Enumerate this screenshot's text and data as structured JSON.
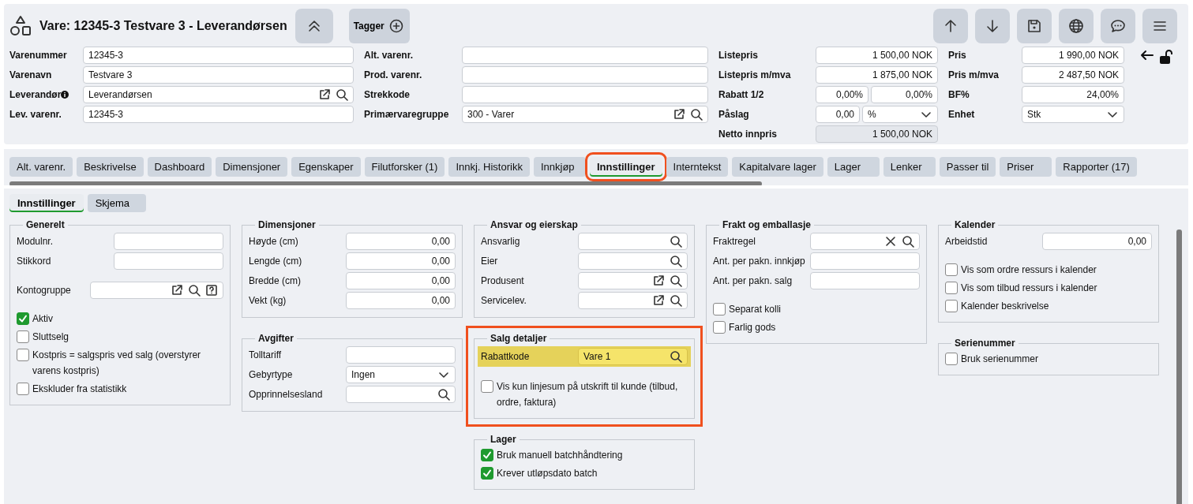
{
  "header": {
    "title": "Vare: 12345-3 Testvare 3 - Leverandørsen",
    "tags_button": "Tagger",
    "toolbar": [
      {
        "kind": "up"
      },
      {
        "kind": "down"
      },
      {
        "kind": "save"
      },
      {
        "kind": "globe"
      },
      {
        "kind": "chat"
      },
      {
        "kind": "menu"
      }
    ]
  },
  "header_fields": [
    [
      {
        "label": "Varenummer",
        "kind": "text",
        "value": "12345-3"
      },
      {
        "label": "Varenavn",
        "kind": "text",
        "value": "Testvare 3"
      },
      {
        "label": "Leverandør",
        "info": true,
        "kind": "lookup",
        "value": "Leverandørsen",
        "actions": [
          {
            "kind": "open"
          },
          {
            "kind": "search"
          }
        ]
      },
      {
        "label": "Lev. varenr.",
        "kind": "text",
        "value": "12345-3"
      }
    ],
    [
      {
        "label": "Alt. varenr.",
        "kind": "text"
      },
      {
        "label": "Prod. varenr.",
        "kind": "text"
      },
      {
        "label": "Strekkode",
        "kind": "text"
      },
      {
        "label": "Primærvaregruppe",
        "kind": "lookup",
        "value": "300 - Varer",
        "actions": [
          {
            "kind": "open"
          },
          {
            "kind": "search"
          }
        ]
      }
    ],
    [
      {
        "label": "Listepris",
        "kind": "number",
        "value": "1 500,00  NOK"
      },
      {
        "label": "Listepris m/mva",
        "kind": "number",
        "value": "1 875,00  NOK"
      },
      {
        "label": "Rabatt 1/2",
        "kind": "pair",
        "parts": [
          {
            "kind": "number",
            "value": "0,00%"
          },
          {
            "kind": "number",
            "value": "0,00%"
          }
        ]
      },
      {
        "label": "Påslag",
        "kind": "pair",
        "parts": [
          {
            "kind": "number",
            "value": "0,00"
          },
          {
            "kind": "select",
            "value": "%"
          }
        ]
      },
      {
        "label": "Netto innpris",
        "kind": "readonly",
        "value": "1 500,00 NOK"
      }
    ],
    [
      {
        "label": "Pris",
        "kind": "number",
        "value": "1 990,00 NOK"
      },
      {
        "label": "Pris m/mva",
        "kind": "number",
        "value": "2 487,50 NOK"
      },
      {
        "label": "BF%",
        "kind": "number",
        "value": "24,00%"
      },
      {
        "label": "Enhet",
        "kind": "select",
        "value": "Stk"
      }
    ]
  ],
  "price_lock": {
    "locked": false
  },
  "tabs": [
    {
      "label": "Alt. varenr.",
      "selected": false,
      "highlighted": false
    },
    {
      "label": "Beskrivelse",
      "selected": false,
      "highlighted": false
    },
    {
      "label": "Dashboard",
      "selected": false,
      "highlighted": false
    },
    {
      "label": "Dimensjoner",
      "selected": false,
      "highlighted": false
    },
    {
      "label": "Egenskaper",
      "selected": false,
      "highlighted": false
    },
    {
      "label": "Filutforsker (1)",
      "selected": false,
      "highlighted": false
    },
    {
      "label": "Innkj. Historikk",
      "selected": false,
      "highlighted": false
    },
    {
      "label": "Innkjøp",
      "selected": false,
      "highlighted": false
    },
    {
      "label": "Innstillinger",
      "selected": true,
      "highlighted": true
    },
    {
      "label": "Interntekst",
      "selected": false,
      "highlighted": false
    },
    {
      "label": "Kapitalvare lager",
      "selected": false,
      "highlighted": false
    },
    {
      "label": "Lager",
      "selected": false,
      "highlighted": false
    },
    {
      "label": "Lenker",
      "selected": false,
      "highlighted": false
    },
    {
      "label": "Passer til",
      "selected": false,
      "highlighted": false
    },
    {
      "label": "Priser",
      "selected": false,
      "highlighted": false
    },
    {
      "label": "Rapporter (17)",
      "selected": false,
      "highlighted": false
    }
  ],
  "subtabs": [
    {
      "label": "Innstillinger",
      "selected": true
    },
    {
      "label": "Skjema",
      "selected": false
    }
  ],
  "groups": [
    [
      {
        "title": "Generelt",
        "highlighted": false,
        "rows": [
          {
            "kind": "text-field",
            "label": "Modulnr."
          },
          {
            "kind": "text-field",
            "label": "Stikkord"
          },
          {
            "kind": "lookup-field",
            "label": "Kontogruppe",
            "actions": [
              {
                "kind": "open"
              },
              {
                "kind": "search"
              },
              {
                "kind": "help"
              }
            ]
          },
          {
            "kind": "checkbox",
            "label": "Aktiv",
            "checked": true
          },
          {
            "kind": "checkbox",
            "label": "Sluttselg",
            "checked": false
          },
          {
            "kind": "checkbox",
            "label": "Kostpris = salgspris ved salg (overstyrer varens kostpris)",
            "checked": false
          },
          {
            "kind": "checkbox",
            "label": "Ekskluder fra statistikk",
            "checked": false
          }
        ]
      }
    ],
    [
      {
        "title": "Dimensjoner",
        "highlighted": false,
        "rows": [
          {
            "kind": "number-field",
            "label": "Høyde (cm)",
            "value": "0,00"
          },
          {
            "kind": "number-field",
            "label": "Lengde (cm)",
            "value": "0,00"
          },
          {
            "kind": "number-field",
            "label": "Bredde (cm)",
            "value": "0,00"
          },
          {
            "kind": "number-field",
            "label": "Vekt (kg)",
            "value": "0,00"
          }
        ]
      },
      {
        "title": "Avgifter",
        "highlighted": false,
        "rows": [
          {
            "kind": "text-field",
            "label": "Tolltariff"
          },
          {
            "kind": "select-field",
            "label": "Gebyrtype",
            "value": "Ingen"
          },
          {
            "kind": "lookup-field",
            "label": "Opprinnelsesland",
            "actions": [
              {
                "kind": "search"
              }
            ]
          }
        ]
      }
    ],
    [
      {
        "title": "Ansvar og eierskap",
        "highlighted": false,
        "rows": [
          {
            "kind": "lookup-field",
            "label": "Ansvarlig",
            "actions": [
              {
                "kind": "search"
              }
            ]
          },
          {
            "kind": "lookup-field",
            "label": "Eier",
            "actions": [
              {
                "kind": "search"
              }
            ]
          },
          {
            "kind": "lookup-field",
            "label": "Produsent",
            "actions": [
              {
                "kind": "open"
              },
              {
                "kind": "search"
              }
            ]
          },
          {
            "kind": "lookup-field",
            "label": "Servicelev.",
            "actions": [
              {
                "kind": "open"
              },
              {
                "kind": "search"
              }
            ]
          }
        ]
      },
      {
        "title": "Salg detaljer",
        "highlighted": true,
        "rows": [
          {
            "kind": "lookup-field",
            "label": "Rabattkode",
            "value": "Vare 1",
            "actions": [
              {
                "kind": "search"
              }
            ],
            "emphasized": true
          },
          {
            "kind": "checkbox",
            "label": "Vis kun linjesum på utskrift til kunde (tilbud, ordre, faktura)",
            "checked": false
          }
        ]
      },
      {
        "title": "Lager",
        "highlighted": false,
        "rows": [
          {
            "kind": "checkbox",
            "label": "Bruk manuell batchhåndtering",
            "checked": true
          },
          {
            "kind": "checkbox",
            "label": "Krever utløpsdato batch",
            "checked": true
          }
        ]
      }
    ],
    [
      {
        "title": "Frakt og emballasje",
        "highlighted": false,
        "rows": [
          {
            "kind": "lookup-field",
            "label": "Fraktregel",
            "actions": [
              {
                "kind": "clear"
              },
              {
                "kind": "search"
              }
            ]
          },
          {
            "kind": "text-field",
            "label": "Ant. per pakn. innkjøp"
          },
          {
            "kind": "text-field",
            "label": "Ant. per pakn. salg"
          },
          {
            "kind": "checkbox",
            "label": "Separat kolli",
            "checked": false
          },
          {
            "kind": "checkbox",
            "label": "Farlig gods",
            "checked": false
          }
        ]
      }
    ],
    [
      {
        "title": "Kalender",
        "highlighted": false,
        "rows": [
          {
            "kind": "number-field",
            "label": "Arbeidstid",
            "value": "0,00"
          },
          {
            "kind": "checkbox",
            "label": "Vis som ordre ressurs i kalender",
            "checked": false
          },
          {
            "kind": "checkbox",
            "label": "Vis som tilbud ressurs i kalender",
            "checked": false
          },
          {
            "kind": "checkbox",
            "label": "Kalender beskrivelse",
            "checked": false
          }
        ]
      },
      {
        "title": "Serienummer",
        "highlighted": false,
        "rows": [
          {
            "kind": "checkbox",
            "label": "Bruk serienummer",
            "checked": false
          }
        ]
      }
    ]
  ]
}
